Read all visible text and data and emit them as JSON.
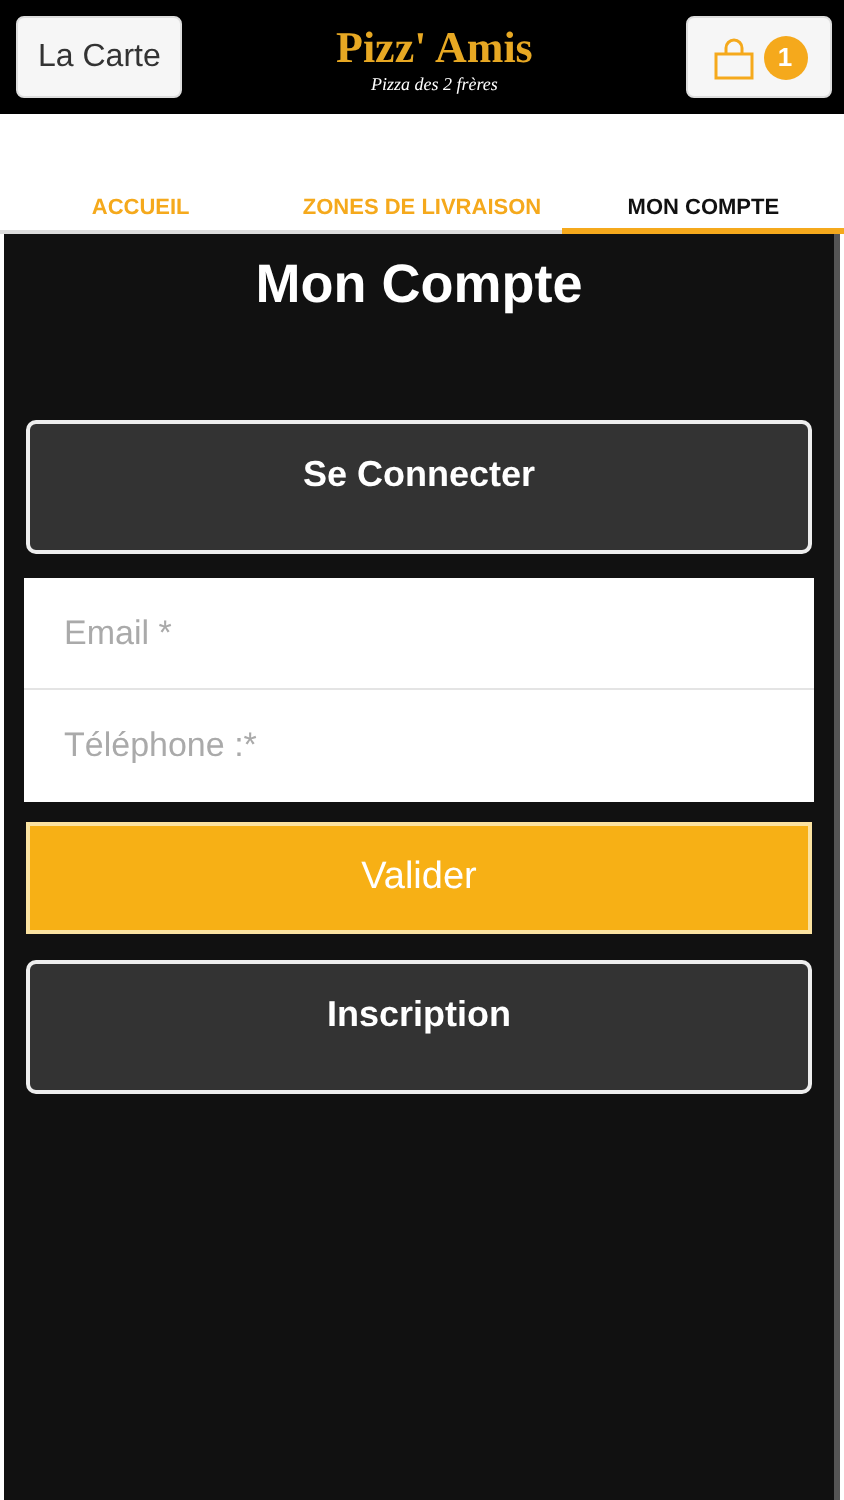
{
  "header": {
    "menu_button": "La Carte",
    "logo": {
      "title": "Pizz' Amis",
      "subtitle": "Pizza des 2 frères"
    },
    "cart_count": "1"
  },
  "tabs": [
    {
      "label": "ACCUEIL",
      "selected": false
    },
    {
      "label": "ZONES DE LIVRAISON",
      "selected": false
    },
    {
      "label": "MON COMPTE",
      "selected": true
    }
  ],
  "page_title": "Mon Compte",
  "login_button": "Se Connecter",
  "fields": [
    {
      "placeholder": "Email *"
    },
    {
      "placeholder": "Téléphone :*"
    }
  ],
  "submit_button": "Valider",
  "signup_button": "Inscription"
}
